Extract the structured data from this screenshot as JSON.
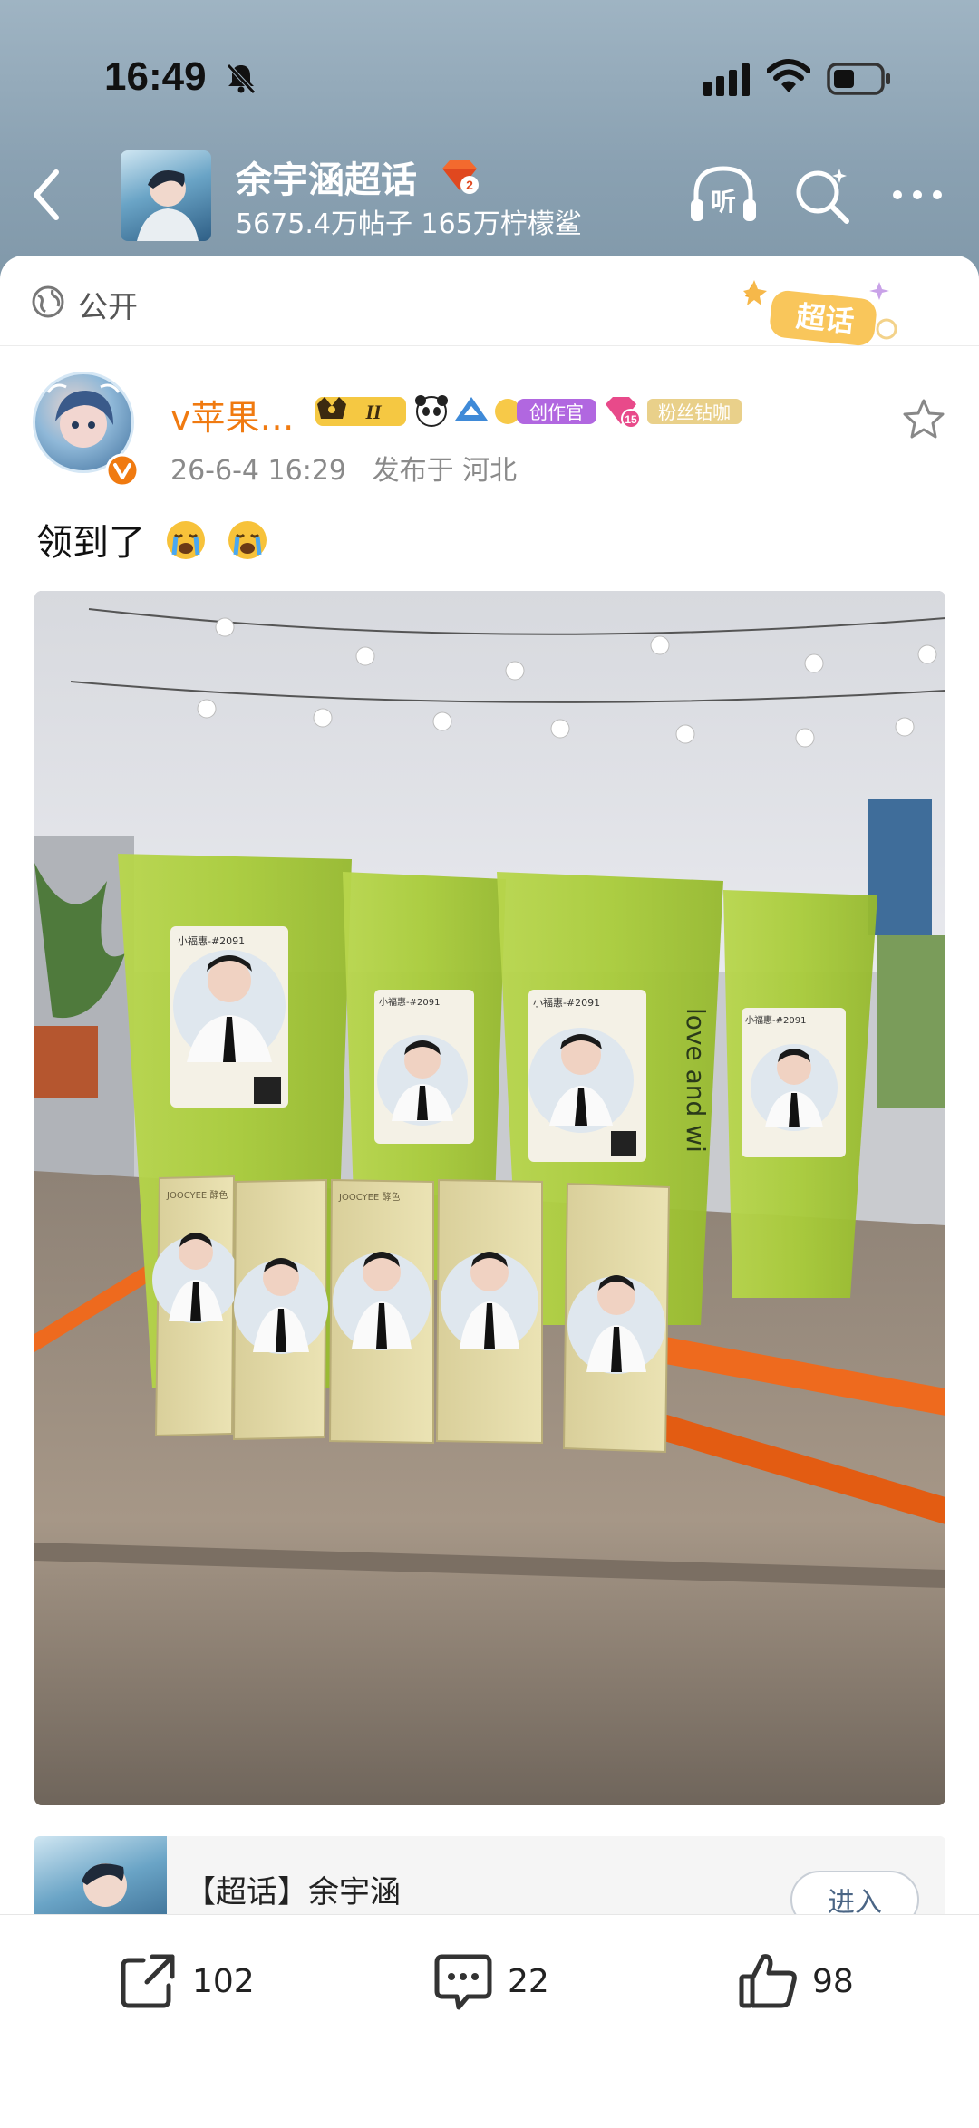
{
  "status_bar": {
    "time": "16:49"
  },
  "header": {
    "title": "余宇涵超话",
    "level": "2",
    "stats": "5675.4万帖子 165万柠檬鲨"
  },
  "post": {
    "visibility": "公开",
    "sticker_text": "超话",
    "username": "v苹果…",
    "badge_labels": [
      "II",
      "创作官",
      "15",
      "粉丝钻咖"
    ],
    "time": "26-6-4 16:29",
    "location": "发布于 河北",
    "text": "领到了",
    "photo_labels": {
      "cup_label_title": "小福惠-#2091",
      "cup_text": "love and wi",
      "box_brand": "JOOCYEE 酵色"
    }
  },
  "topic": {
    "title": "【超话】余宇涵",
    "enter": "进入"
  },
  "actions": {
    "share": "102",
    "comment": "22",
    "like": "98"
  },
  "colors": {
    "username": "#f07a10",
    "header_bg": "#8aa1b2",
    "enter_text": "#4a6585"
  }
}
